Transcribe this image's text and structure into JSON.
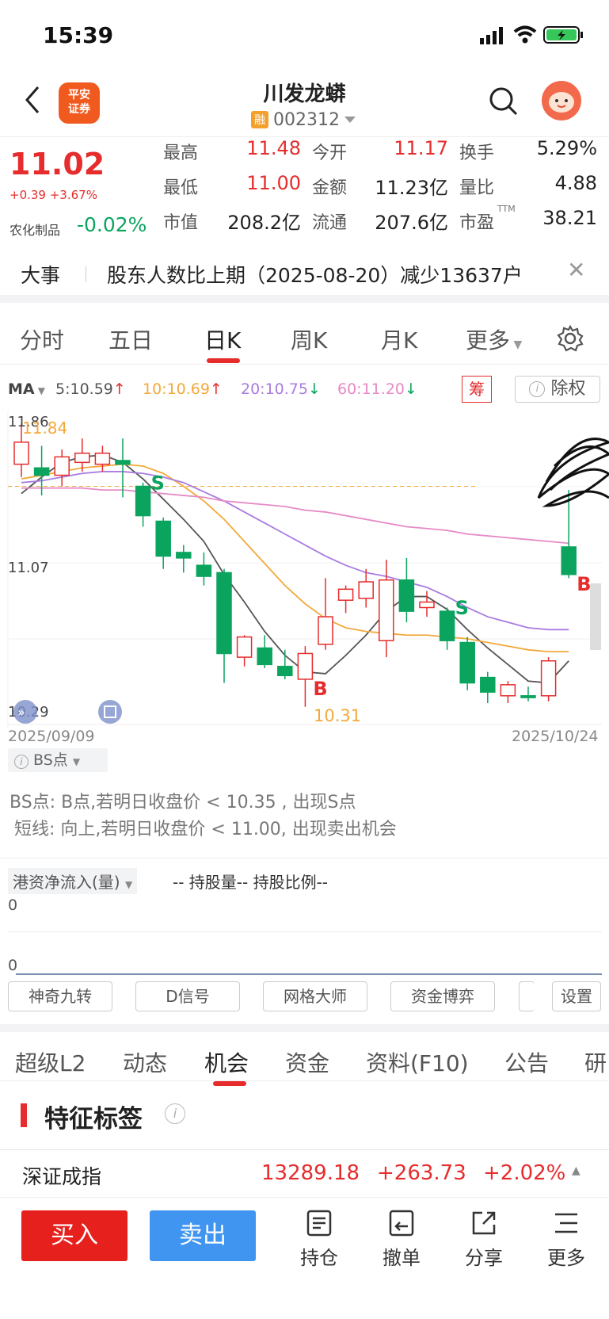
{
  "status": {
    "time": "15:39"
  },
  "header": {
    "broker_logo": "平安证券",
    "stock_name": "川发龙蟒",
    "margin_tag": "融",
    "code": "002312"
  },
  "quote": {
    "price": "11.02",
    "change": "+0.39 +3.67%",
    "sector": "农化制品",
    "sector_change": "-0.02%",
    "rows": [
      [
        {
          "label": "最高",
          "value": "11.48"
        },
        {
          "label": "今开",
          "value": "11.17"
        },
        {
          "label": "换手",
          "value": "5.29%"
        }
      ],
      [
        {
          "label": "最低",
          "value": "11.00"
        },
        {
          "label": "金额",
          "value": "11.23亿"
        },
        {
          "label": "量比",
          "value": "4.88"
        }
      ],
      [
        {
          "label": "市值",
          "value": "208.2亿"
        },
        {
          "label": "流通",
          "value": "207.6亿"
        },
        {
          "label": "市盈",
          "value": "38.21"
        }
      ]
    ],
    "pe_suffix": "TTM"
  },
  "news": {
    "tag": "大事",
    "text": "股东人数比上期（2025-08-20）减少13637户"
  },
  "k_tabs": [
    "分时",
    "五日",
    "日K",
    "周K",
    "月K",
    "更多"
  ],
  "k_active": 2,
  "ma": {
    "label": "MA",
    "items": [
      {
        "text": "5:10.59",
        "arrow": "↑",
        "color": "#555555"
      },
      {
        "text": "10:10.69",
        "arrow": "↑",
        "color": "#f2a93b"
      },
      {
        "text": "20:10.75",
        "arrow": "↓",
        "color": "#a97be0"
      },
      {
        "text": "60:11.20",
        "arrow": "↓",
        "color": "#e68ac5"
      }
    ],
    "chip_button": "筹",
    "ex_rights_button": "除权"
  },
  "chart_data": {
    "type": "candlestick",
    "y_labels": [
      "11.86",
      "11.07",
      "10.29"
    ],
    "high_annotation": "11.84",
    "low_annotation": "10.31",
    "start_date": "2025/09/09",
    "end_date": "2025/10/24",
    "ylim": [
      10.29,
      11.86
    ],
    "candles": [
      {
        "o": 11.62,
        "c": 11.74,
        "h": 11.84,
        "l": 11.55
      },
      {
        "o": 11.6,
        "c": 11.56,
        "h": 11.72,
        "l": 11.45
      },
      {
        "o": 11.56,
        "c": 11.66,
        "h": 11.7,
        "l": 11.5
      },
      {
        "o": 11.63,
        "c": 11.68,
        "h": 11.76,
        "l": 11.58
      },
      {
        "o": 11.62,
        "c": 11.68,
        "h": 11.72,
        "l": 11.58
      },
      {
        "o": 11.64,
        "c": 11.62,
        "h": 11.76,
        "l": 11.44
      },
      {
        "o": 11.5,
        "c": 11.34,
        "h": 11.52,
        "l": 11.28
      },
      {
        "o": 11.31,
        "c": 11.12,
        "h": 11.33,
        "l": 11.05
      },
      {
        "o": 11.14,
        "c": 11.11,
        "h": 11.18,
        "l": 11.03
      },
      {
        "o": 11.07,
        "c": 11.01,
        "h": 11.14,
        "l": 10.96
      },
      {
        "o": 11.03,
        "c": 10.59,
        "h": 11.05,
        "l": 10.43
      },
      {
        "o": 10.57,
        "c": 10.68,
        "h": 10.69,
        "l": 10.52
      },
      {
        "o": 10.62,
        "c": 10.53,
        "h": 10.69,
        "l": 10.51
      },
      {
        "o": 10.52,
        "c": 10.47,
        "h": 10.61,
        "l": 10.45
      },
      {
        "o": 10.45,
        "c": 10.59,
        "h": 10.63,
        "l": 10.3
      },
      {
        "o": 10.64,
        "c": 10.79,
        "h": 11.0,
        "l": 10.61
      },
      {
        "o": 10.88,
        "c": 10.94,
        "h": 10.96,
        "l": 10.81
      },
      {
        "o": 10.89,
        "c": 10.98,
        "h": 11.05,
        "l": 10.84
      },
      {
        "o": 10.66,
        "c": 10.99,
        "h": 11.1,
        "l": 10.57
      },
      {
        "o": 10.99,
        "c": 10.82,
        "h": 11.11,
        "l": 10.76
      },
      {
        "o": 10.84,
        "c": 10.87,
        "h": 10.93,
        "l": 10.79
      },
      {
        "o": 10.82,
        "c": 10.66,
        "h": 10.84,
        "l": 10.61
      },
      {
        "o": 10.65,
        "c": 10.43,
        "h": 10.68,
        "l": 10.39
      },
      {
        "o": 10.46,
        "c": 10.38,
        "h": 10.49,
        "l": 10.32
      },
      {
        "o": 10.36,
        "c": 10.42,
        "h": 10.44,
        "l": 10.32
      },
      {
        "o": 10.36,
        "c": 10.35,
        "h": 10.41,
        "l": 10.33
      },
      {
        "o": 10.36,
        "c": 10.55,
        "h": 10.57,
        "l": 10.33
      },
      {
        "o": 11.17,
        "c": 11.02,
        "h": 11.48,
        "l": 11.0
      }
    ],
    "ma_lines": [
      {
        "name": "MA5",
        "color": "#555555",
        "values": [
          11.46,
          11.55,
          11.63,
          11.66,
          11.67,
          11.63,
          11.54,
          11.43,
          11.32,
          11.2,
          11.02,
          10.87,
          10.71,
          10.58,
          10.49,
          10.48,
          10.58,
          10.69,
          10.82,
          10.9,
          10.9,
          10.83,
          10.72,
          10.62,
          10.53,
          10.44,
          10.43,
          10.55
        ]
      },
      {
        "name": "MA10",
        "color": "#f2a93b",
        "values": [
          11.54,
          11.56,
          11.58,
          11.6,
          11.61,
          11.62,
          11.61,
          11.57,
          11.5,
          11.42,
          11.32,
          11.2,
          11.08,
          10.96,
          10.86,
          10.78,
          10.73,
          10.71,
          10.7,
          10.69,
          10.69,
          10.68,
          10.67,
          10.65,
          10.63,
          10.61,
          10.6,
          10.6
        ]
      },
      {
        "name": "MA20",
        "color": "#a97be0",
        "values": [
          11.52,
          11.53,
          11.55,
          11.57,
          11.58,
          11.58,
          11.57,
          11.55,
          11.52,
          11.47,
          11.42,
          11.36,
          11.3,
          11.24,
          11.18,
          11.12,
          11.07,
          11.03,
          11.01,
          10.98,
          10.95,
          10.9,
          10.84,
          10.79,
          10.76,
          10.73,
          10.72,
          10.72
        ]
      },
      {
        "name": "MA60",
        "color": "#e68ac5",
        "values": [
          11.49,
          11.49,
          11.49,
          11.49,
          11.48,
          11.48,
          11.47,
          11.46,
          11.45,
          11.44,
          11.42,
          11.41,
          11.4,
          11.39,
          11.37,
          11.36,
          11.34,
          11.32,
          11.3,
          11.28,
          11.27,
          11.26,
          11.24,
          11.23,
          11.22,
          11.21,
          11.2,
          11.19
        ]
      }
    ],
    "markers": [
      {
        "index": 6,
        "label": "S",
        "color": "#0aa45e"
      },
      {
        "index": 14,
        "label": "B",
        "color": "#e62c2c"
      },
      {
        "index": 21,
        "label": "S",
        "color": "#0aa45e"
      },
      {
        "index": 27,
        "label": "B",
        "color": "#e62c2c"
      }
    ],
    "up_color": "#e62c2c",
    "down_color": "#0aa45e",
    "ref_line": 11.5
  },
  "bs": {
    "button": "BS点",
    "line1": "BS点: B点,若明日收盘价 < 10.35 , 出现S点",
    "line2": "短线: 向上,若明日收盘价 < 11.00, 出现卖出机会"
  },
  "hk": {
    "title": "港资净流入(量)",
    "extra": "--  持股量--  持股比例--",
    "zero1": "0",
    "zero2": "0"
  },
  "tools": [
    "神奇九转",
    "D信号",
    "网格大师",
    "资金博弈",
    "设置"
  ],
  "lower_tabs": [
    "超级L2",
    "动态",
    "机会",
    "资金",
    "资料(F10)",
    "公告",
    "研"
  ],
  "lower_active": 2,
  "feature": {
    "title": "特征标签"
  },
  "ticker": {
    "name": "深证成指",
    "value": "13289.18",
    "change": "+263.73",
    "pct": "+2.02%"
  },
  "bottom": {
    "buy": "买入",
    "sell": "卖出",
    "actions": [
      "持仓",
      "撤单",
      "分享",
      "更多"
    ]
  }
}
